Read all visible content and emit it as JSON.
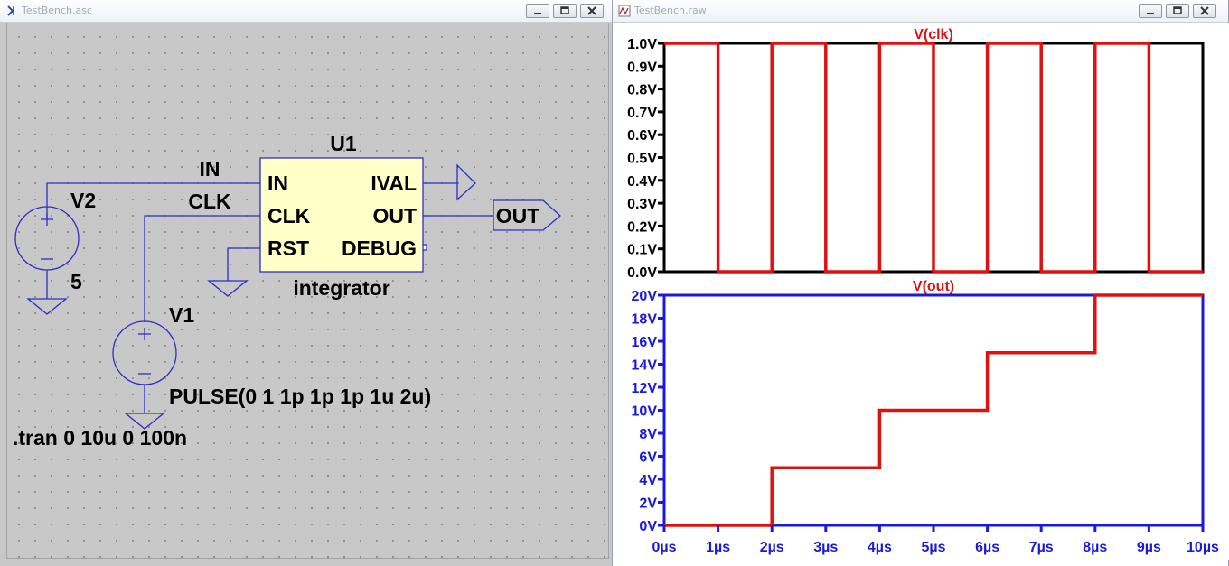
{
  "left_window": {
    "title": "TestBench.asc",
    "component_name": "U1",
    "component_type": "integrator",
    "pins_left": [
      "IN",
      "CLK",
      "RST"
    ],
    "pins_right": [
      "IVAL",
      "OUT",
      "DEBUG"
    ],
    "net_in_label": "IN",
    "net_clk_label": "CLK",
    "out_port_label": "OUT",
    "v2_name": "V2",
    "v2_value": "5",
    "v1_name": "V1",
    "v1_value": "PULSE(0 1 1p 1p 1p 1u 2u)",
    "tran_directive": ".tran 0 10u 0 100n",
    "colors": {
      "wire": "#2b2fc8",
      "component_fill": "#ffffc8",
      "canvas": "#c8c8c8"
    }
  },
  "right_window": {
    "title": "TestBench.raw",
    "colors": {
      "trace": "#e01010",
      "axis_top": "#000000",
      "axis_bottom": "#1a1adc"
    }
  },
  "chart_data": [
    {
      "type": "line",
      "series": [
        {
          "name": "V(clk)",
          "color": "#e01010"
        }
      ],
      "x": [
        0,
        1,
        1,
        2,
        2,
        3,
        3,
        4,
        4,
        5,
        5,
        6,
        6,
        7,
        7,
        8,
        8,
        9,
        9,
        10
      ],
      "y": [
        1,
        1,
        0,
        0,
        1,
        1,
        0,
        0,
        1,
        1,
        0,
        0,
        1,
        1,
        0,
        0,
        1,
        1,
        0,
        0
      ],
      "xlim": [
        0,
        10
      ],
      "ylim": [
        0,
        1
      ],
      "y_ticks": [
        "1.0V",
        "0.9V",
        "0.8V",
        "0.7V",
        "0.6V",
        "0.5V",
        "0.4V",
        "0.3V",
        "0.2V",
        "0.1V",
        "0.0V"
      ],
      "title": "V(clk)"
    },
    {
      "type": "line",
      "series": [
        {
          "name": "V(out)",
          "color": "#e01010"
        }
      ],
      "x": [
        0,
        2,
        2,
        4,
        4,
        6,
        6,
        8,
        8,
        10
      ],
      "y": [
        0,
        0,
        5,
        5,
        10,
        10,
        15,
        15,
        20,
        20
      ],
      "xlim": [
        0,
        10
      ],
      "ylim": [
        0,
        20
      ],
      "y_ticks": [
        "20V",
        "18V",
        "16V",
        "14V",
        "12V",
        "10V",
        "8V",
        "6V",
        "4V",
        "2V",
        "0V"
      ],
      "x_ticks": [
        "0µs",
        "1µs",
        "2µs",
        "3µs",
        "4µs",
        "5µs",
        "6µs",
        "7µs",
        "8µs",
        "9µs",
        "10µs"
      ],
      "title": "V(out)"
    }
  ]
}
